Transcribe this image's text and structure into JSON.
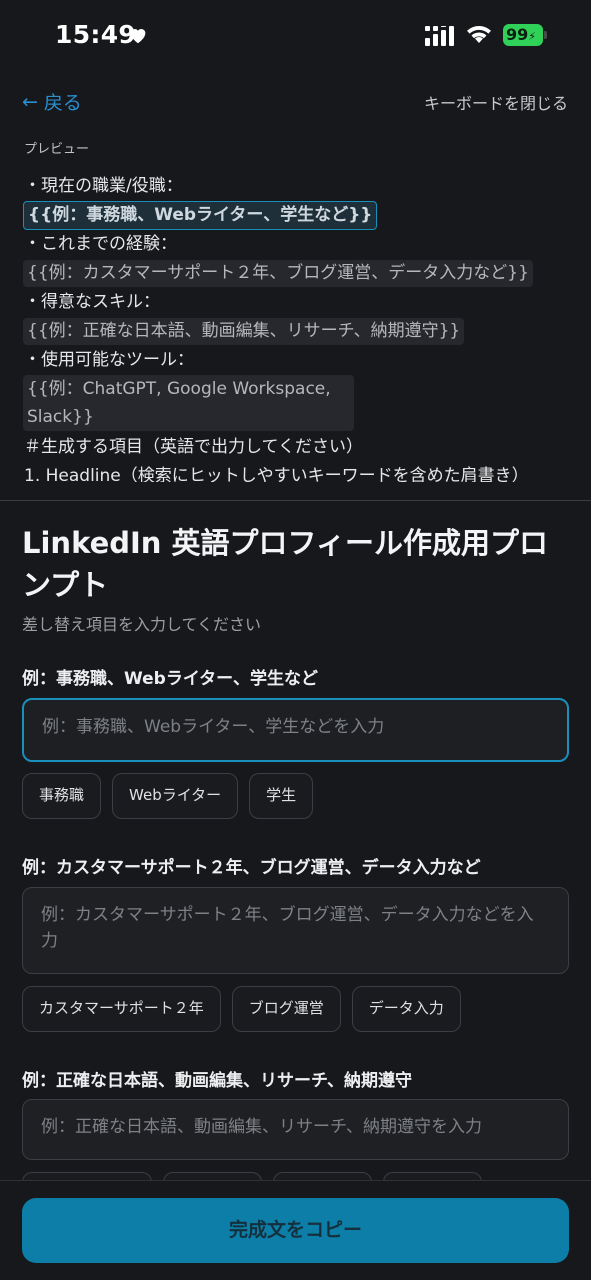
{
  "status": {
    "time": "15:49",
    "battery": "99"
  },
  "header": {
    "back_label": "戻る",
    "close_keyboard_label": "キーボードを閉じる"
  },
  "preview": {
    "label": "プレビュー",
    "lines": {
      "l1": "・現在の職業/役職：",
      "l1_chip": "{{例：事務職、Webライター、学生など}}",
      "l2": "・これまでの経験：",
      "l2_chip": "{{例：カスタマーサポート２年、ブログ運営、データ入力など}}",
      "l3": "・得意なスキル：",
      "l3_chip": "{{例：正確な日本語、動画編集、リサーチ、納期遵守}}",
      "l4": "・使用可能なツール：",
      "l4_chip": "{{例：ChatGPT, Google Workspace, Slack}}",
      "l5": "＃生成する項目（英語で出力してください）",
      "l6": "1. Headline（検索にヒットしやすいキーワードを含めた肩書き）"
    }
  },
  "form": {
    "title": "LinkedIn 英語プロフィール作成用プロンプト",
    "subtitle": "差し替え項目を入力してください",
    "fields": [
      {
        "label": "例：事務職、Webライター、学生など",
        "placeholder": "例：事務職、Webライター、学生などを入力",
        "chips": [
          "事務職",
          "Webライター",
          "学生"
        ]
      },
      {
        "label": "例：カスタマーサポート２年、ブログ運営、データ入力など",
        "placeholder": "例：カスタマーサポート２年、ブログ運営、データ入力などを入力",
        "chips": [
          "カスタマーサポート２年",
          "ブログ運営",
          "データ入力"
        ]
      },
      {
        "label": "例：正確な日本語、動画編集、リサーチ、納期遵守",
        "placeholder": "例：正確な日本語、動画編集、リサーチ、納期遵守を入力"
      }
    ]
  },
  "bottom": {
    "copy_label": "完成文をコピー"
  },
  "colors": {
    "accent": "#1a8fbb",
    "button": "#0c7ea8",
    "background": "#17181b",
    "battery": "#30d158"
  }
}
